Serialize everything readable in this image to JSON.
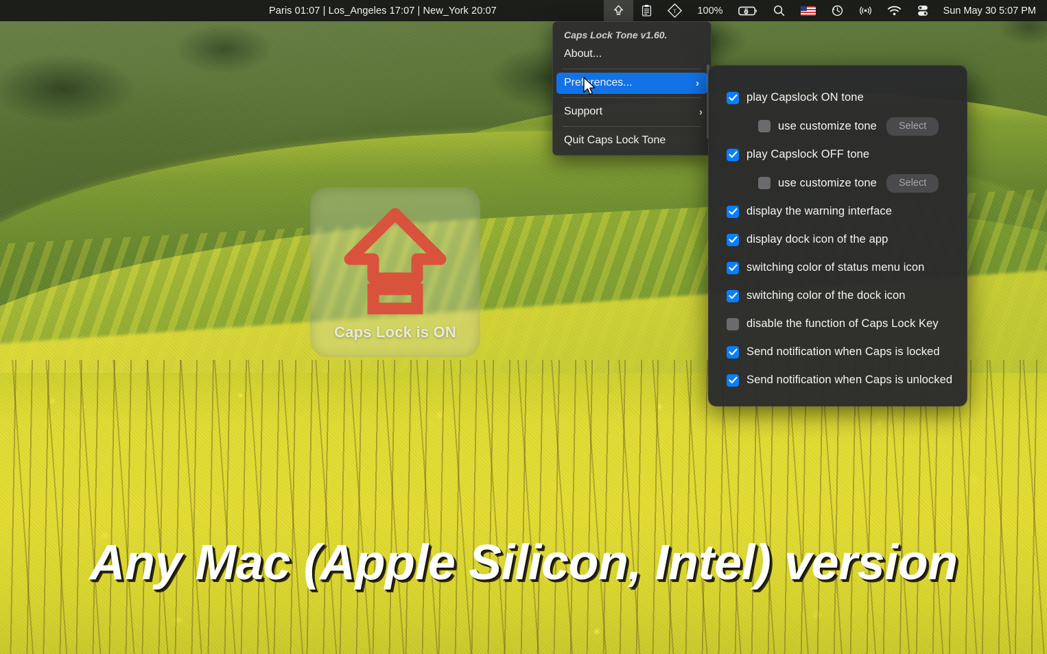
{
  "menubar": {
    "clocks": "Paris 01:07  | Los_Angeles 17:07  | New_York 20:07",
    "items": [
      {
        "name": "caps-lock-status-icon",
        "label": "",
        "icon": "caps-lock-arrow-icon",
        "active": true
      },
      {
        "name": "clipboard-status-icon",
        "label": "",
        "icon": "clipboard-icon",
        "active": false
      },
      {
        "name": "textual-status-icon",
        "label": "",
        "icon": "diamond-t-icon",
        "active": false
      },
      {
        "name": "battery-percent",
        "label": "100%",
        "icon": "",
        "active": false
      },
      {
        "name": "battery-status-icon",
        "label": "",
        "icon": "battery-charging-icon",
        "active": false
      },
      {
        "name": "spotlight-search-icon",
        "label": "",
        "icon": "search-icon",
        "active": false
      },
      {
        "name": "input-language-flag",
        "label": "",
        "icon": "us-flag-icon",
        "active": false
      },
      {
        "name": "time-machine-icon",
        "label": "",
        "icon": "clock-history-icon",
        "active": false
      },
      {
        "name": "airplay-icon",
        "label": "",
        "icon": "broadcast-icon",
        "active": false
      },
      {
        "name": "wifi-icon",
        "label": "",
        "icon": "wifi-icon",
        "active": false
      },
      {
        "name": "control-center-icon",
        "label": "",
        "icon": "control-center-icon",
        "active": false
      }
    ],
    "datetime": "Sun May 30  5:07 PM"
  },
  "dropdown": {
    "header": "Caps Lock Tone v1.60.",
    "items": [
      {
        "label": "About...",
        "chevron": "",
        "selected": false
      },
      {
        "label": "Preferences...",
        "chevron": "›",
        "selected": true
      },
      {
        "label": "Support",
        "chevron": "›",
        "selected": false
      },
      {
        "label": "Quit Caps Lock Tone",
        "chevron": "",
        "selected": false
      }
    ]
  },
  "preferences": {
    "rows": [
      {
        "label": "play Capslock ON tone",
        "checked": true,
        "indent": false,
        "button": ""
      },
      {
        "label": "use customize tone",
        "checked": false,
        "indent": true,
        "button": "Select"
      },
      {
        "label": "play Capslock OFF tone",
        "checked": true,
        "indent": false,
        "button": ""
      },
      {
        "label": "use customize tone",
        "checked": false,
        "indent": true,
        "button": "Select"
      },
      {
        "label": "display the warning interface",
        "checked": true,
        "indent": false,
        "button": ""
      },
      {
        "label": "display dock icon of the app",
        "checked": true,
        "indent": false,
        "button": ""
      },
      {
        "label": "switching color of status menu icon",
        "checked": true,
        "indent": false,
        "button": ""
      },
      {
        "label": "switching color of the dock icon",
        "checked": true,
        "indent": false,
        "button": ""
      },
      {
        "label": "disable the function of Caps Lock Key",
        "checked": false,
        "indent": false,
        "button": ""
      },
      {
        "label": "Send notification when Caps is locked",
        "checked": true,
        "indent": false,
        "button": ""
      },
      {
        "label": "Send notification when Caps is unlocked",
        "checked": true,
        "indent": false,
        "button": ""
      }
    ]
  },
  "hud": {
    "text": "Caps Lock is ON",
    "arrow_color": "#d9533c"
  },
  "banner": {
    "text": "Any Mac (Apple Silicon, Intel) version"
  },
  "colors": {
    "accent_blue": "#0a7ffb",
    "menu_highlight": "#1273e8",
    "panel_bg": "#2a2a2c",
    "menubar_bg": "#161616"
  }
}
